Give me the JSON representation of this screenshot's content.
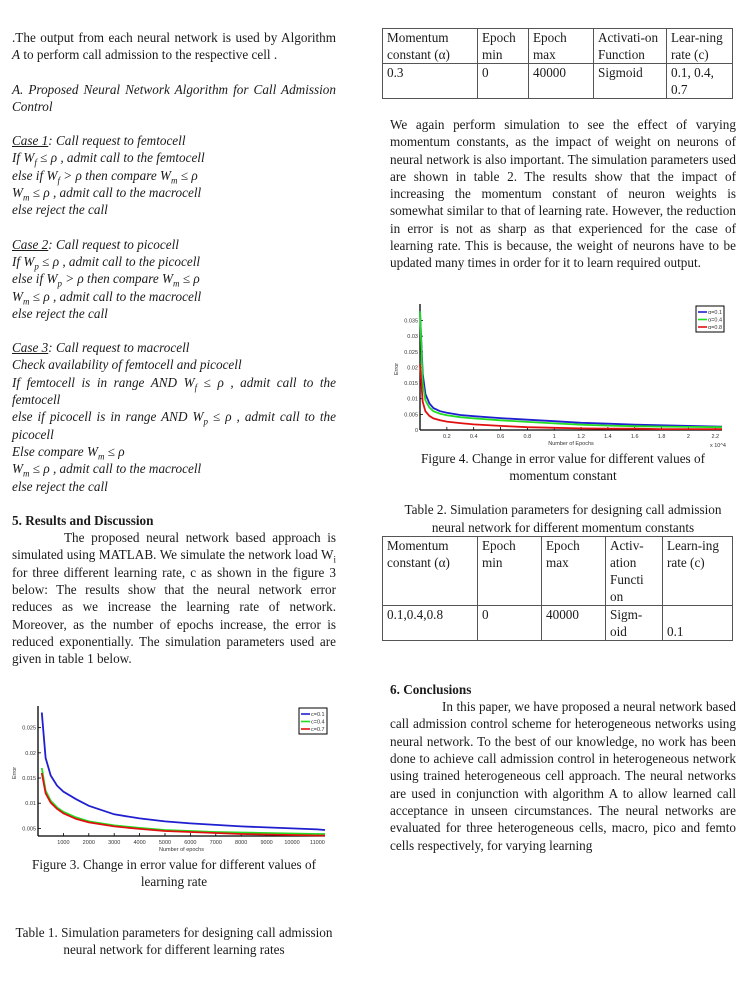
{
  "left": {
    "intro": ".The output from each neural network is used by Algorithm A to perform call admission to the respective cell .",
    "intro_parts": [
      ".The output from each neural network is used by Algorithm ",
      "A",
      " to perform call admission to the respective cell ."
    ],
    "section_a_title": "A. Proposed Neural Network Algorithm for Call Admission Control",
    "case1": {
      "label": "Case 1",
      "title": ": Call request to femtocell",
      "lines": [
        "If W_f ≤ ρ , admit call to the femtocell",
        "else if W_f > ρ then compare W_m ≤ ρ",
        "W_m ≤ ρ , admit call to the macrocell",
        "else reject the call"
      ]
    },
    "case2": {
      "label": "Case 2",
      "title": ":  Call request to picocell",
      "lines": [
        "If W_p ≤ ρ , admit call to the picocell",
        "else if W_p > ρ then compare W_m ≤ ρ",
        "W_m ≤ ρ , admit call to the macrocell",
        "else reject the call"
      ]
    },
    "case3": {
      "label": "Case 3",
      "title": ":  Call request to macrocell",
      "lines": [
        "Check availability of femtocell and picocell",
        "If femtocell is in range AND W_f ≤ ρ , admit call to the femtocell",
        "else if picocell is in range AND W_p ≤ ρ , admit call to the picocell",
        "Else compare W_m ≤ ρ",
        "W_m ≤ ρ , admit call to the macrocell",
        "else reject the call"
      ]
    },
    "section5_title": "5. Results and Discussion",
    "section5_body": "The proposed neural network based approach is simulated using MATLAB. We simulate the network load W_i for three different learning rate, c as shown in the figure 3 below: The results show that the neural network error reduces as we increase the learning rate of network. Moreover, as the number of epochs increase, the error is reduced exponentially. The simulation parameters used are given in table 1 below.",
    "figure3_caption": "Figure 3. Change in error value for different values of learning rate",
    "table1_caption": "Table 1. Simulation parameters for designing call admission neural network for different learning rates"
  },
  "right": {
    "table1": {
      "headers": [
        "Momentum constant (α)",
        "Epoch min",
        "Epoch max",
        "Activati-on Function",
        "Lear-ning rate (c)"
      ],
      "rows": [
        [
          "0.3",
          "0",
          "40000",
          "Sigmoid",
          "0.1, 0.4, 0.7"
        ]
      ]
    },
    "para_momentum": "We again perform simulation to see the effect of varying momentum constants, as the impact of weight on neurons of neural network is also important. The simulation parameters used are shown in table 2. The results show that the impact of increasing the momentum constant of neuron weights is somewhat similar to that of learning rate. However, the reduction in error is not as sharp as that experienced for the case of learning rate. This is because, the weight of neurons have to be updated many times in order for it to learn required output.",
    "figure4_caption": "Figure 4. Change in error value for different values of momentum constant",
    "table2_caption": "Table 2. Simulation parameters for designing call admission neural network for different momentum constants",
    "table2": {
      "headers": [
        "Momentum constant (α)",
        "Epoch min",
        "Epoch max",
        "Activ-ation Functi on",
        "Learn-ing rate (c)"
      ],
      "rows": [
        [
          "0.1,0.4,0.8",
          "0",
          "40000",
          "Sigm-oid",
          "0.1"
        ]
      ]
    },
    "section6_title": "6. Conclusions",
    "section6_body": "In this paper, we have proposed a neural network based call admission control scheme for heterogeneous networks using neural network. To the best of our knowledge, no work has been done to achieve call admission control in heterogeneous network using trained heterogeneous cell approach. The neural networks are used in conjunction with algorithm A to allow learned call acceptance in unseen circumstances. The neural networks are evaluated for three heterogeneous cells, macro, pico and femto cells respectively, for varying learning"
  },
  "chart_data": [
    {
      "id": "figure3",
      "type": "line",
      "title": "",
      "xlabel": "Number of epochs",
      "ylabel": "Error",
      "xlim": [
        0,
        11300
      ],
      "ylim": [
        0.0035,
        0.0285
      ],
      "xticks": [
        1000,
        2000,
        3000,
        4000,
        5000,
        6000,
        7000,
        8000,
        9000,
        10000,
        11000
      ],
      "yticks": [
        0.005,
        0.01,
        0.015,
        0.02,
        0.025
      ],
      "ytick_labels": [
        "0.005",
        "0.01",
        "0.015",
        "0.02",
        "0.025"
      ],
      "legend": "top-right",
      "grid": false,
      "colors": [
        "#1f1fd0",
        "#22dd22",
        "#e01010"
      ],
      "x": [
        150,
        300,
        500,
        750,
        1000,
        1500,
        2000,
        3000,
        4000,
        5000,
        6000,
        7000,
        8000,
        9000,
        10000,
        11000,
        11300
      ],
      "series": [
        {
          "name": "c=0.1",
          "values": [
            0.028,
            0.019,
            0.0155,
            0.0135,
            0.0123,
            0.0108,
            0.0095,
            0.0078,
            0.007,
            0.0064,
            0.006,
            0.0057,
            0.0054,
            0.0052,
            0.005,
            0.0048,
            0.0047
          ]
        },
        {
          "name": "c=0.4",
          "values": [
            0.017,
            0.0125,
            0.0105,
            0.0092,
            0.0083,
            0.0072,
            0.0064,
            0.0056,
            0.0051,
            0.0047,
            0.0045,
            0.0043,
            0.0042,
            0.0041,
            0.004,
            0.0039,
            0.0039
          ]
        },
        {
          "name": "c=0.7",
          "values": [
            0.016,
            0.012,
            0.0101,
            0.0089,
            0.008,
            0.0069,
            0.0062,
            0.0054,
            0.0049,
            0.0045,
            0.0043,
            0.0041,
            0.0039,
            0.0038,
            0.0037,
            0.0036,
            0.0036
          ]
        }
      ]
    },
    {
      "id": "figure4",
      "type": "line",
      "title": "",
      "xlabel": "Number of Epochs",
      "x_multiplier_label": "x 10^4",
      "ylabel": "Error",
      "xlim": [
        0,
        2.25
      ],
      "ylim": [
        0,
        0.039
      ],
      "xticks": [
        0.2,
        0.4,
        0.6,
        0.8,
        1,
        1.2,
        1.4,
        1.6,
        1.8,
        2,
        2.2
      ],
      "yticks": [
        0,
        0.005,
        0.01,
        0.015,
        0.02,
        0.025,
        0.03,
        0.035
      ],
      "ytick_labels": [
        "0",
        "0.005",
        "0.01",
        "0.015",
        "0.02",
        "0.025",
        "0.03",
        "0.035"
      ],
      "legend": "top-right",
      "grid": false,
      "colors": [
        "#1f1fd0",
        "#22dd22",
        "#e01010"
      ],
      "x": [
        0.0,
        0.02,
        0.04,
        0.07,
        0.1,
        0.15,
        0.2,
        0.3,
        0.4,
        0.6,
        0.8,
        1.0,
        1.2,
        1.4,
        1.6,
        1.8,
        2.0,
        2.25
      ],
      "series": [
        {
          "name": "α=0.1",
          "values": [
            0.038,
            0.018,
            0.0115,
            0.0085,
            0.007,
            0.006,
            0.0055,
            0.0048,
            0.0044,
            0.0038,
            0.0033,
            0.0028,
            0.0023,
            0.002,
            0.0017,
            0.0015,
            0.0013,
            0.0011
          ]
        },
        {
          "name": "α=0.4",
          "values": [
            0.038,
            0.015,
            0.0095,
            0.0072,
            0.006,
            0.0052,
            0.0047,
            0.0041,
            0.0037,
            0.0031,
            0.0026,
            0.0021,
            0.0017,
            0.0014,
            0.0012,
            0.0011,
            0.001,
            0.0009
          ]
        },
        {
          "name": "α=0.8",
          "values": [
            0.021,
            0.009,
            0.006,
            0.0045,
            0.0037,
            0.0031,
            0.0027,
            0.0022,
            0.0018,
            0.0013,
            0.0009,
            0.0007,
            0.0005,
            0.0004,
            0.0004,
            0.0003,
            0.0003,
            0.0003
          ]
        }
      ]
    }
  ]
}
